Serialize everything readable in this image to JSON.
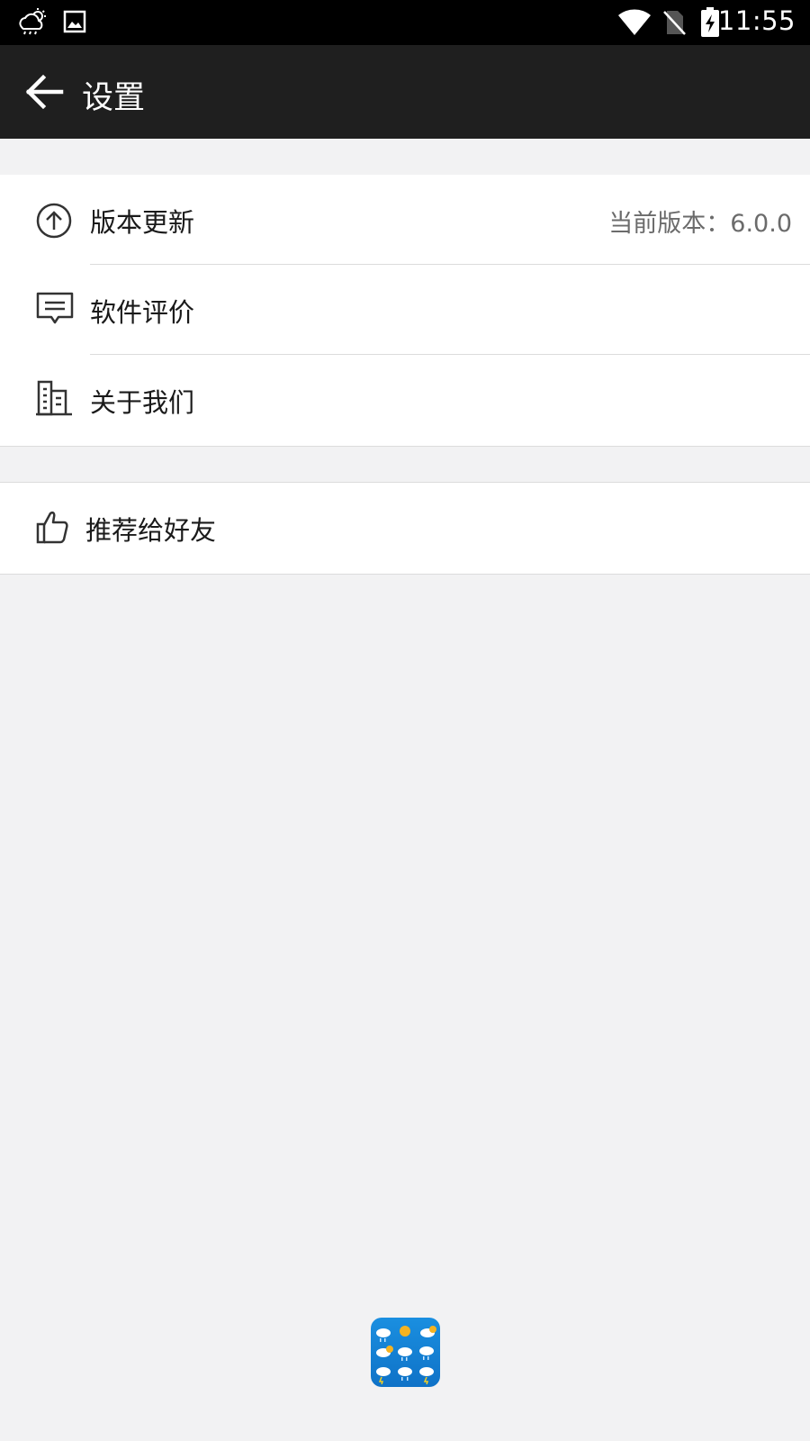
{
  "status_bar": {
    "time": "11:55",
    "icons": [
      "weather-notification-icon",
      "image-notification-icon",
      "wifi-icon",
      "no-sim-icon",
      "battery-charging-icon"
    ]
  },
  "app_bar": {
    "title": "设置",
    "back_icon": "arrow-left-icon"
  },
  "settings": {
    "group1": [
      {
        "label": "版本更新",
        "value": "当前版本：6.0.0",
        "icon": "upload-circle-icon"
      },
      {
        "label": "软件评价",
        "icon": "comment-icon"
      },
      {
        "label": "关于我们",
        "icon": "building-icon"
      }
    ],
    "group2": [
      {
        "label": "推荐给好友",
        "icon": "thumbs-up-icon"
      }
    ]
  },
  "colors": {
    "status_bar": "#000000",
    "app_bar": "#1f1f1f",
    "background": "#f2f2f3",
    "row_background": "#ffffff",
    "secondary_text": "#6b6b6b",
    "logo_blue": "#1a8fe0"
  }
}
